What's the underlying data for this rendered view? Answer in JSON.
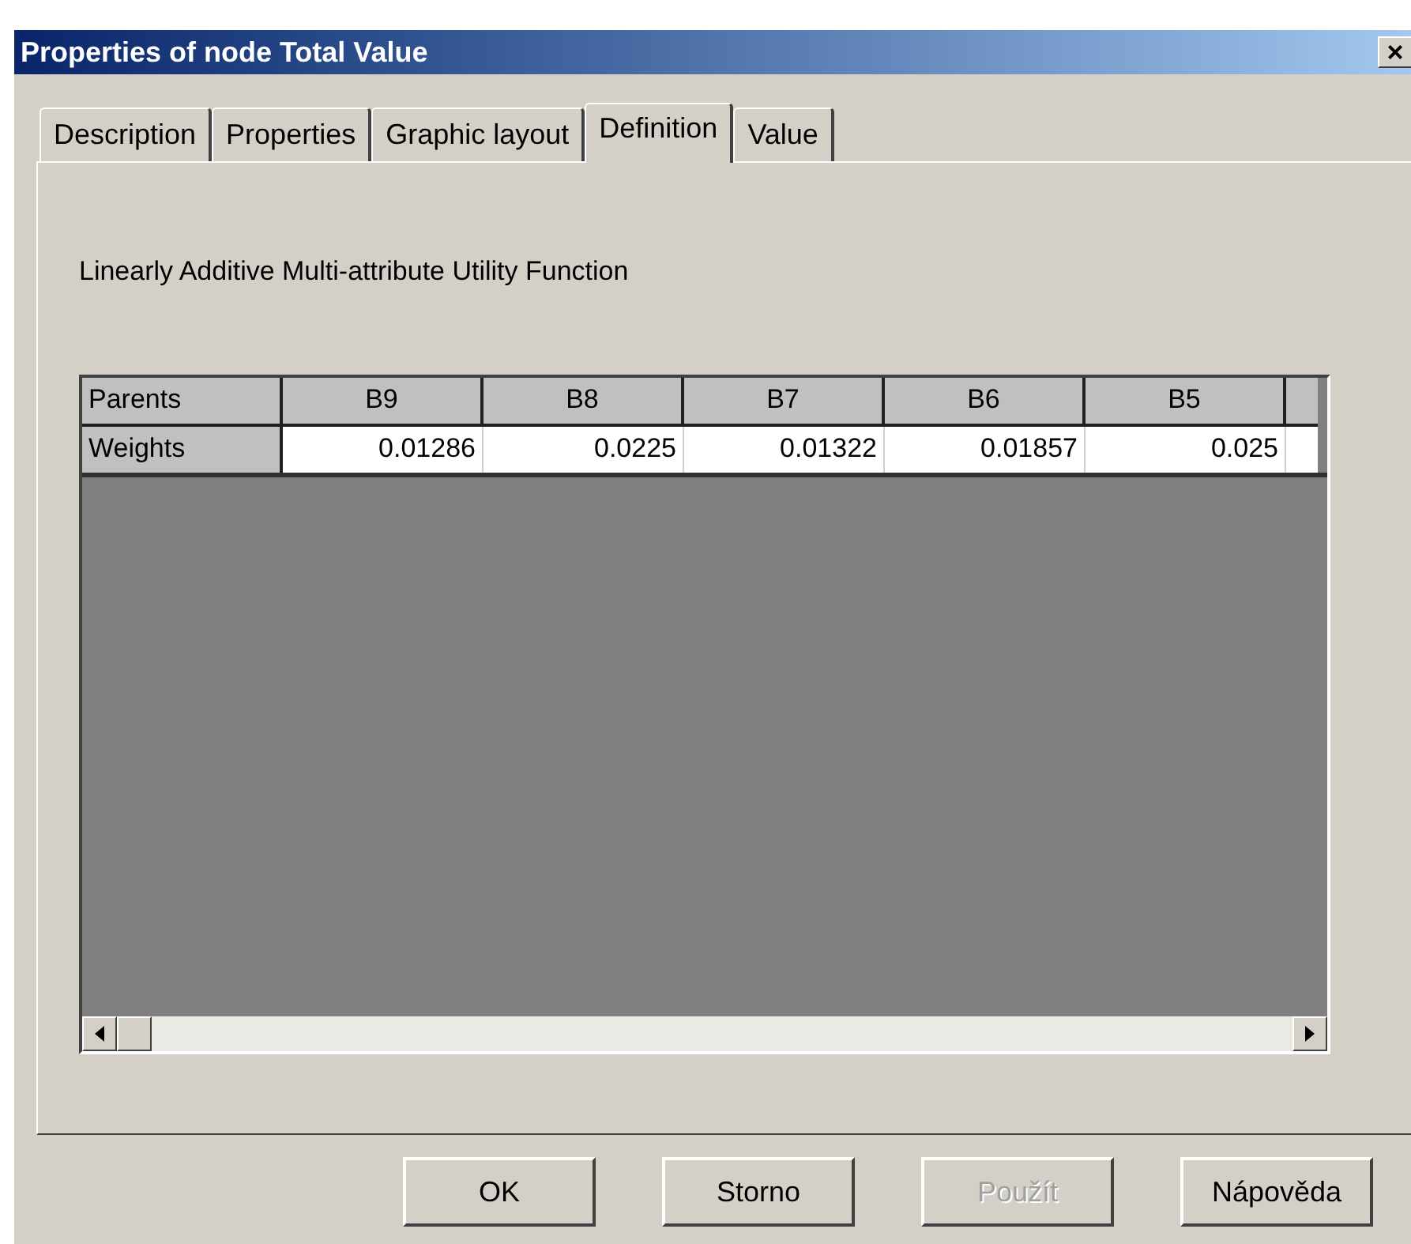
{
  "window": {
    "title": "Properties of node Total Value",
    "close": "×"
  },
  "tabs": [
    {
      "label": "Description",
      "selected": false
    },
    {
      "label": "Properties",
      "selected": false
    },
    {
      "label": "Graphic layout",
      "selected": false
    },
    {
      "label": "Definition",
      "selected": true
    },
    {
      "label": "Value",
      "selected": false
    }
  ],
  "function_label": "Linearly Additive Multi-attribute Utility Function",
  "table": {
    "columns": [
      "Parents",
      "B9",
      "B8",
      "B7",
      "B6",
      "B5"
    ],
    "rows": [
      [
        "Weights",
        "0.01286",
        "0.0225",
        "0.01322",
        "0.01857",
        "0.025"
      ]
    ]
  },
  "buttons": [
    {
      "label": "OK",
      "disabled": false
    },
    {
      "label": "Storno",
      "disabled": false
    },
    {
      "label": "Použít",
      "disabled": true
    },
    {
      "label": "Nápověda",
      "disabled": false
    }
  ]
}
